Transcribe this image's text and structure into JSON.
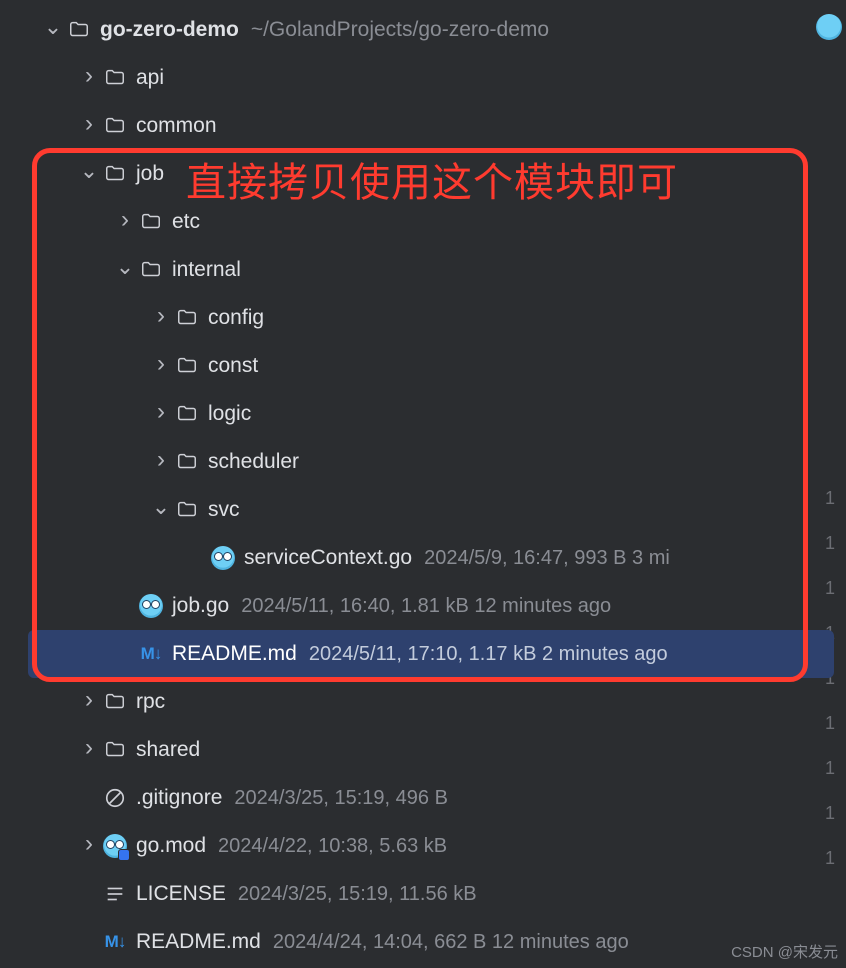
{
  "project": {
    "name": "go-zero-demo",
    "path": "~/GolandProjects/go-zero-demo"
  },
  "annotation": {
    "text": "直接拷贝使用这个模块即可"
  },
  "tree": [
    {
      "id": "root",
      "depth": 0,
      "chev": "down",
      "icon": "folder",
      "name": "go-zero-demo",
      "bold": true,
      "pathLabel": "~/GolandProjects/go-zero-demo"
    },
    {
      "id": "api",
      "depth": 1,
      "chev": "right",
      "icon": "folder",
      "name": "api"
    },
    {
      "id": "common",
      "depth": 1,
      "chev": "right",
      "icon": "folder",
      "name": "common"
    },
    {
      "id": "job",
      "depth": 1,
      "chev": "down",
      "icon": "folder",
      "name": "job"
    },
    {
      "id": "etc",
      "depth": 2,
      "chev": "right",
      "icon": "folder",
      "name": "etc"
    },
    {
      "id": "internal",
      "depth": 2,
      "chev": "down",
      "icon": "folder",
      "name": "internal"
    },
    {
      "id": "config",
      "depth": 3,
      "chev": "right",
      "icon": "folder",
      "name": "config"
    },
    {
      "id": "const",
      "depth": 3,
      "chev": "right",
      "icon": "folder",
      "name": "const"
    },
    {
      "id": "logic",
      "depth": 3,
      "chev": "right",
      "icon": "folder",
      "name": "logic"
    },
    {
      "id": "scheduler",
      "depth": 3,
      "chev": "right",
      "icon": "folder",
      "name": "scheduler"
    },
    {
      "id": "svc",
      "depth": 3,
      "chev": "down",
      "icon": "folder",
      "name": "svc"
    },
    {
      "id": "svcctx",
      "depth": 4,
      "chev": "none",
      "icon": "gopher",
      "name": "serviceContext.go",
      "meta": "2024/5/9, 16:47, 993 B 3 mi"
    },
    {
      "id": "jobgo",
      "depth": 2,
      "chev": "none",
      "icon": "gopher",
      "name": "job.go",
      "meta": "2024/5/11, 16:40, 1.81 kB 12 minutes ago"
    },
    {
      "id": "readme1",
      "depth": 2,
      "chev": "none",
      "icon": "md",
      "name": "README.md",
      "meta": "2024/5/11, 17:10, 1.17 kB 2 minutes ago",
      "selected": true
    },
    {
      "id": "rpc",
      "depth": 1,
      "chev": "right",
      "icon": "folder",
      "name": "rpc"
    },
    {
      "id": "shared",
      "depth": 1,
      "chev": "right",
      "icon": "folder",
      "name": "shared"
    },
    {
      "id": "gitignore",
      "depth": 1,
      "chev": "none",
      "icon": "ignore",
      "name": ".gitignore",
      "meta": "2024/3/25, 15:19, 496 B"
    },
    {
      "id": "gomod",
      "depth": 1,
      "chev": "right",
      "icon": "gomod",
      "name": "go.mod",
      "meta": "2024/4/22, 10:38, 5.63 kB"
    },
    {
      "id": "license",
      "depth": 1,
      "chev": "none",
      "icon": "lines",
      "name": "LICENSE",
      "meta": "2024/3/25, 15:19, 11.56 kB"
    },
    {
      "id": "readme2",
      "depth": 1,
      "chev": "none",
      "icon": "md",
      "name": "README.md",
      "meta": "2024/4/24, 14:04, 662 B 12 minutes ago"
    }
  ],
  "gutter_hints": [
    "1",
    "1",
    "1",
    "1",
    "1",
    "1",
    "1",
    "1",
    "1",
    "1"
  ],
  "watermark": "CSDN @宋发元"
}
